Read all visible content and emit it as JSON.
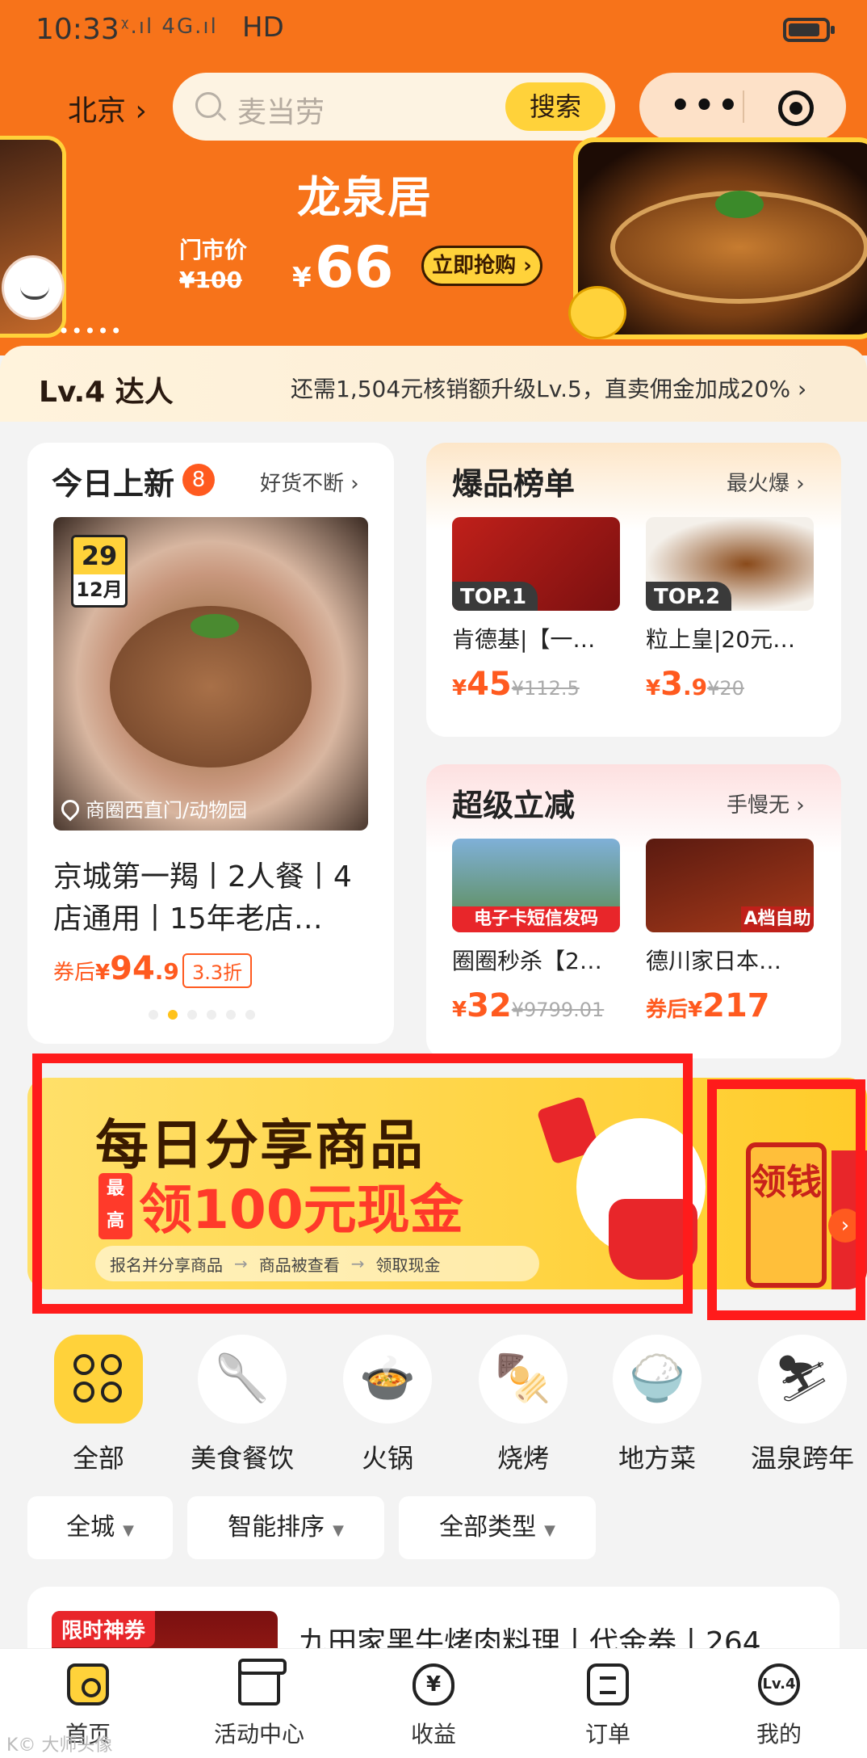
{
  "statusbar": {
    "time": "10:33",
    "signal": "ᵡ.ıl 4G.ıl",
    "network": "HD"
  },
  "header": {
    "city": "北京",
    "search_placeholder": "麦当劳",
    "search_button": "搜索",
    "capsule_more": "•••"
  },
  "banner": {
    "title": "龙泉居",
    "price_label": "门市价",
    "original_price": "¥100",
    "currency": "¥",
    "sale_price": "66",
    "buy_button": "立即抢购",
    "dots": "•••••"
  },
  "level": {
    "badge": "Lv.4 达人",
    "tip": "还需1,504元核销额升级Lv.5，直卖佣金加成20%"
  },
  "new_today": {
    "title": "今日上新",
    "badge_count": "8",
    "more": "好货不断",
    "date_day": "29",
    "date_month": "12月",
    "location": "商圈西直门/动物园",
    "name": "京城第一羯丨2人餐丨4店通用丨15年老店…",
    "price_prefix": "券后",
    "currency": "¥",
    "price_int": "94",
    "price_dec": ".9",
    "discount": "3.3折"
  },
  "hot_list": {
    "title": "爆品榜单",
    "more": "最火爆",
    "items": [
      {
        "rank": "TOP.1",
        "name": "肯德基|【一…",
        "currency": "¥",
        "price_int": "45",
        "price_dec": "",
        "orig": "¥112.5"
      },
      {
        "rank": "TOP.2",
        "name": "粒上皇|20元…",
        "currency": "¥",
        "price_int": "3",
        "price_dec": ".9",
        "orig": "¥20"
      }
    ]
  },
  "super_cut": {
    "title": "超级立减",
    "more": "手慢无",
    "items": [
      {
        "band": "电子卡短信发码",
        "name": "圈圈秒杀【2…",
        "prefix": "",
        "currency": "¥",
        "price_int": "32",
        "orig": "¥9799.01"
      },
      {
        "band": "A档自助",
        "name": "德川家日本…",
        "prefix": "券后",
        "currency": "¥",
        "price_int": "217",
        "orig": ""
      }
    ]
  },
  "promo": {
    "title": "每日分享商品",
    "highest": "最高",
    "subtitle": "领100元现金",
    "steps": [
      "报名并分享商品",
      "商品被查看",
      "领取现金"
    ],
    "claim": "领钱"
  },
  "categories": [
    {
      "label": "全部",
      "icon": "grid-icon",
      "glyph": ""
    },
    {
      "label": "美食餐饮",
      "icon": "utensils-icon",
      "glyph": "🥄"
    },
    {
      "label": "火锅",
      "icon": "hotpot-icon",
      "glyph": "🍲"
    },
    {
      "label": "烧烤",
      "icon": "skewer-icon",
      "glyph": "🍢"
    },
    {
      "label": "地方菜",
      "icon": "bowl-icon",
      "glyph": "🍚"
    },
    {
      "label": "温泉跨年",
      "icon": "skier-icon",
      "glyph": "⛷"
    }
  ],
  "filters": [
    "全城",
    "智能排序",
    "全部类型"
  ],
  "list_item": {
    "tag": "限时神券",
    "name": "九田家黑牛烤肉料理丨代金券丨264"
  },
  "tabs": [
    {
      "label": "首页",
      "icon": "home-icon",
      "inner": ""
    },
    {
      "label": "活动中心",
      "icon": "gift-icon",
      "inner": ""
    },
    {
      "label": "收益",
      "icon": "money-bag-icon",
      "inner": "¥"
    },
    {
      "label": "订单",
      "icon": "order-icon",
      "inner": ""
    },
    {
      "label": "我的",
      "icon": "profile-icon",
      "inner": "Lv.4"
    }
  ],
  "watermark": "K© 大师头像",
  "colors": {
    "brand_orange": "#f7731a",
    "accent_yellow": "#ffd23a",
    "price_red": "#ff5a1f",
    "highlight_red": "#ff1b1b"
  }
}
